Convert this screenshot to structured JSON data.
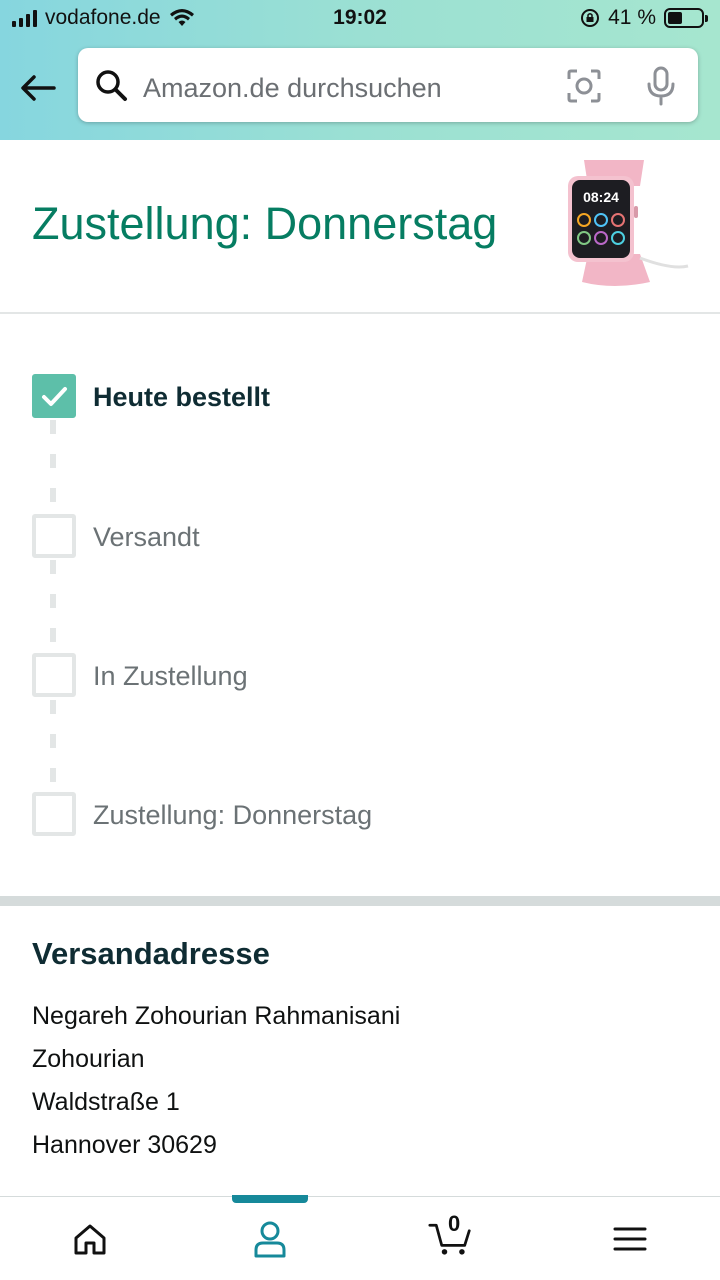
{
  "status_bar": {
    "carrier": "vodafone.de",
    "time": "19:02",
    "battery_percent": "41 %"
  },
  "search": {
    "placeholder": "Amazon.de durchsuchen"
  },
  "delivery": {
    "title": "Zustellung: Donnerstag"
  },
  "timeline": {
    "steps": [
      {
        "label": "Heute bestellt",
        "done": true
      },
      {
        "label": "Versandt",
        "done": false
      },
      {
        "label": "In Zustellung",
        "done": false
      },
      {
        "label": "Zustellung: Donnerstag",
        "done": false
      }
    ]
  },
  "address": {
    "heading": "Versandadresse",
    "lines": [
      "Negareh Zohourian Rahmanisani",
      "Zohourian",
      "Waldstraße 1",
      "Hannover 30629"
    ]
  },
  "nav": {
    "cart_count": "0",
    "items": [
      "home-icon",
      "account-icon",
      "cart-icon",
      "menu-icon"
    ],
    "active": "account-icon"
  },
  "colors": {
    "accent_green": "#067d62",
    "check_green": "#5dbfa9",
    "nav_active": "#16899a",
    "header_gradient_start": "#86d6df",
    "header_gradient_end": "#a6e6cf"
  }
}
